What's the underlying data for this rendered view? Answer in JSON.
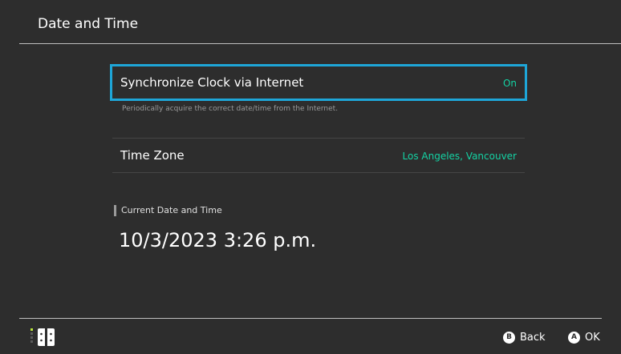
{
  "header": {
    "title": "Date and Time"
  },
  "settings": {
    "sync_clock": {
      "label": "Synchronize Clock via Internet",
      "value": "On",
      "description": "Periodically acquire the correct date/time from the Internet."
    },
    "time_zone": {
      "label": "Time Zone",
      "value": "Los Angeles, Vancouver"
    }
  },
  "current": {
    "heading": "Current Date and Time",
    "value": "10/3/2023 3:26 p.m."
  },
  "footer": {
    "controller_icon": "joy-con-controller-icon",
    "buttons": [
      {
        "glyph": "B",
        "label": "Back"
      },
      {
        "glyph": "A",
        "label": "OK"
      }
    ]
  },
  "colors": {
    "background": "#2d2d2d",
    "accent_value": "#14d3a4",
    "focus_border": "#1ea6d8",
    "controller_green": "#b9e53a"
  }
}
